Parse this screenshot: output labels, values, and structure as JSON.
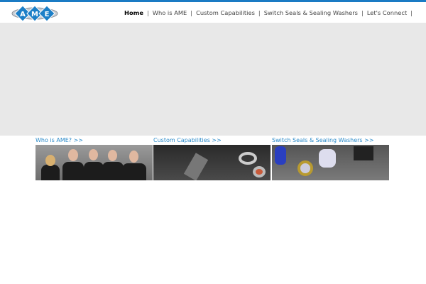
{
  "logo": {
    "text": "AME"
  },
  "nav": {
    "items": [
      {
        "label": "Home",
        "active": true
      },
      {
        "label": "Who is AME"
      },
      {
        "label": "Custom Capabilities"
      },
      {
        "label": "Switch Seals & Sealing Washers"
      },
      {
        "label": "Let's Connect"
      }
    ],
    "separator": "|"
  },
  "cards": [
    {
      "title": "Who is AME? >>"
    },
    {
      "title": "Custom Capabilities >>"
    },
    {
      "title": "Switch Seals & Sealing Washers >>"
    }
  ],
  "colors": {
    "accent": "#1a7bc4",
    "link": "#2a8ac9",
    "hero": "#e8e8e8"
  }
}
